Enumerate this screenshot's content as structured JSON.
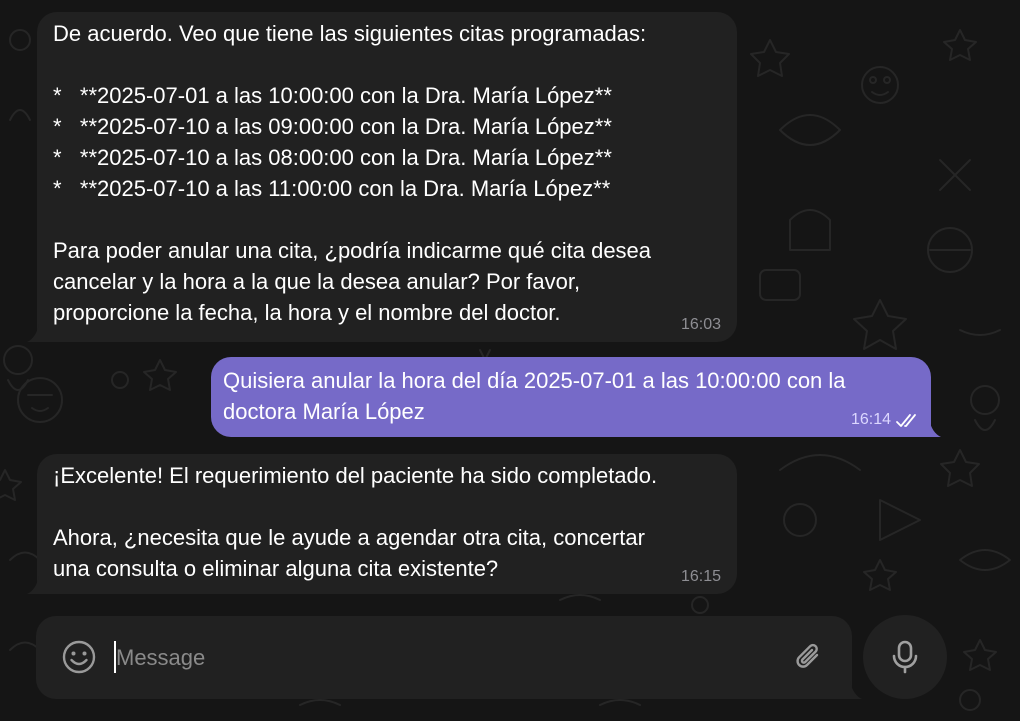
{
  "messages": [
    {
      "direction": "incoming",
      "text": "De acuerdo. Veo que tiene las siguientes citas programadas:\n\n*   **2025-07-01 a las 10:00:00 con la Dra. María López**\n*   **2025-07-10 a las 09:00:00 con la Dra. María López**\n*   **2025-07-10 a las 08:00:00 con la Dra. María López**\n*   **2025-07-10 a las 11:00:00 con la Dra. María López**\n\nPara poder anular una cita, ¿podría indicarme qué cita desea\ncancelar y la hora a la que la desea anular? Por favor,\nproporcione la fecha, la hora y el nombre del doctor.",
      "time": "16:03"
    },
    {
      "direction": "outgoing",
      "text": "Quisiera anular la hora del día 2025-07-01 a las 10:00:00 con la\ndoctora María López",
      "time": "16:14",
      "status_icon": "double-check-icon"
    },
    {
      "direction": "incoming",
      "text": "¡Excelente! El requerimiento del paciente ha sido completado.\n\nAhora, ¿necesita que le ayude a agendar otra cita, concertar\nuna consulta o eliminar alguna cita existente?",
      "time": "16:15"
    }
  ],
  "composer": {
    "placeholder": "Message",
    "value": "",
    "emoji_icon": "smiley-icon",
    "attach_icon": "paperclip-icon",
    "mic_icon": "microphone-icon"
  },
  "colors": {
    "background": "#151515",
    "incoming_bubble": "#212121",
    "outgoing_bubble": "#766ac8",
    "timestamp": "#8e8e93"
  }
}
